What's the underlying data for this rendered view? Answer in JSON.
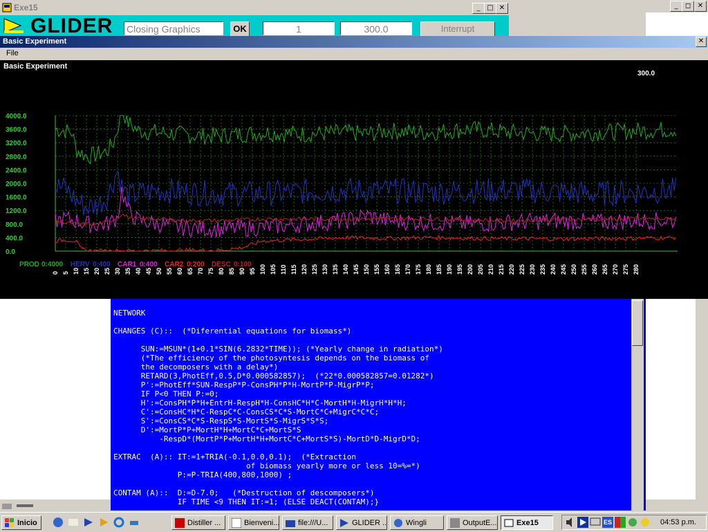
{
  "top_window": {
    "title": "Exe15",
    "logo_text": "GLIDER",
    "status_field": "Closing Graphics",
    "ok_label": "OK",
    "counter_field": "1",
    "time_field": "300.0",
    "interrupt_label": "Interrupt",
    "controls": [
      "_",
      "□",
      "✕"
    ]
  },
  "right_window": {
    "controls": [
      "_",
      "◻",
      "✕"
    ]
  },
  "experiment_window": {
    "title": "Basic Experiment",
    "menu": [
      "File"
    ],
    "chart_title": "Basic Experiment",
    "time_display": "300.0",
    "close_label": "✕"
  },
  "chart_data": {
    "type": "line",
    "title": "Basic Experiment",
    "ylim": [
      0,
      4000
    ],
    "y_ticks": [
      "4000.0",
      "3600.0",
      "3200.0",
      "2800.0",
      "2400.0",
      "2000.0",
      "1600.0",
      "1200.0",
      "800.0",
      "400.0",
      "0.0"
    ],
    "x_ticks": [
      "0",
      "5",
      "10",
      "15",
      "20",
      "25",
      "30",
      "35",
      "40",
      "45",
      "50",
      "55",
      "60",
      "65",
      "70",
      "75",
      "80",
      "85",
      "90",
      "95",
      "100",
      "105",
      "110",
      "115",
      "120",
      "125",
      "130",
      "135",
      "140",
      "145",
      "150",
      "155",
      "160",
      "165",
      "170",
      "175",
      "180",
      "185",
      "190",
      "195",
      "200",
      "205",
      "210",
      "215",
      "220",
      "225",
      "230",
      "235",
      "240",
      "245",
      "250",
      "255",
      "260",
      "265",
      "270",
      "275",
      "280"
    ],
    "xlim": [
      0,
      300
    ],
    "grid": true,
    "legend_position": "bottom-left",
    "series": [
      {
        "name": "PROD",
        "scale": "0:4000",
        "color": "#22aa22",
        "x": [
          0,
          5,
          8,
          10,
          15,
          20,
          25,
          28,
          30,
          32,
          35,
          40,
          50,
          60,
          70,
          80,
          90,
          100,
          120,
          140,
          150,
          160,
          180,
          200,
          220,
          240,
          260,
          280,
          300
        ],
        "y": [
          3600,
          3550,
          3500,
          3000,
          2800,
          2850,
          2950,
          3200,
          3600,
          4200,
          3800,
          3550,
          3500,
          3450,
          3400,
          3400,
          3450,
          3500,
          3450,
          3500,
          3450,
          3550,
          3500,
          3600,
          3500,
          3450,
          3500,
          3550,
          3600
        ]
      },
      {
        "name": "HERV",
        "scale": "0:400",
        "color": "#2233bb",
        "x": [
          0,
          5,
          10,
          15,
          20,
          25,
          30,
          32,
          35,
          40,
          50,
          60,
          80,
          100,
          140,
          180,
          220,
          260,
          300
        ],
        "y": [
          1900,
          1850,
          1500,
          1300,
          1350,
          1600,
          2400,
          1900,
          1600,
          1700,
          1800,
          1750,
          1700,
          1700,
          1800,
          1750,
          1800,
          1700,
          1800
        ]
      },
      {
        "name": "CAR1",
        "scale": "0:400",
        "color": "#dd22dd",
        "x": [
          0,
          5,
          10,
          15,
          20,
          25,
          30,
          32,
          35,
          40,
          50,
          60,
          80,
          100,
          120,
          140,
          150,
          160,
          180,
          200,
          220,
          240,
          260,
          280,
          300
        ],
        "y": [
          900,
          950,
          900,
          800,
          780,
          800,
          1000,
          1800,
          1200,
          900,
          800,
          700,
          650,
          700,
          800,
          900,
          1050,
          900,
          850,
          800,
          850,
          900,
          850,
          900,
          900
        ]
      },
      {
        "name": "CAR2",
        "scale": "0:200",
        "color": "#ee2222",
        "x": [
          0,
          5,
          10,
          12,
          15,
          20,
          30,
          32,
          35,
          40,
          60,
          80,
          90,
          100,
          120,
          140,
          160,
          180,
          200,
          240,
          280,
          300
        ],
        "y": [
          300,
          330,
          300,
          80,
          10,
          10,
          10,
          10,
          10,
          10,
          20,
          30,
          100,
          300,
          350,
          400,
          380,
          400,
          380,
          360,
          380,
          400
        ]
      },
      {
        "name": "DESC",
        "scale": "0:100",
        "color": "#bb2222",
        "x": [
          0,
          5,
          10,
          15,
          20,
          25,
          30,
          32,
          35,
          40,
          50,
          60,
          80,
          100,
          140,
          180,
          220,
          260,
          300
        ],
        "y": [
          900,
          850,
          800,
          800,
          800,
          850,
          1000,
          1100,
          1000,
          950,
          950,
          900,
          900,
          950,
          950,
          950,
          900,
          950,
          950
        ]
      }
    ]
  },
  "code": {
    "lines": [
      "NETWORK",
      "",
      "CHANGES (C)::  (*Diferential equations for biomass*)",
      "",
      "      SUN:=MSUN*(1+0.1*SIN(6.2832*TIME)); (*Yearly change in radiation*)",
      "      (*The efficiency of the photosyntesis depends on the biomass of",
      "      the decomposers with a delay*)",
      "      RETARD(3,PhotEff,0.5,D*0.000582857);  (*22*0.000582857=0.01282*)",
      "      P':=PhotEff*SUN-RespP*P-ConsPH*P*H-MortP*P-MigrP*P;",
      "      IF P<0 THEN P:=0;",
      "      H':=ConsPH*P*H+EntrH-RespH*H-ConsHC*H*C-MortH*H-MigrH*H*H;",
      "      C':=ConsHC*H*C-RespC*C-ConsCS*C*S-MortC*C+MigrC*C*C;",
      "      S':=ConsCS*C*S-RespS*S-MortS*S-MigrS*S*S;",
      "      D':=MortP*P+MortH*H+MortC*C+MortS*S",
      "          -RespD*(MortP*P+MortH*H+MortC*C+MortS*S)-MortD*D-MigrD*D;",
      "",
      "EXTRAC  (A):: IT:=1+TRIA(-0.1,0.0,0.1);  (*Extraction",
      "                             of biomass yearly more or less 10=%=*)",
      "              P:=P-TRIA(400,800,1000) ;",
      "",
      "CONTAM (A)::  D:=D-7.0;   (*Destruction of descomposers*)",
      "              IF TIME <9 THEN IT:=1; (ELSE DEACT(CONTAM);}"
    ]
  },
  "taskbar": {
    "start_label": "Inicio",
    "tasks": [
      "Distiller ...",
      "Bienveni...",
      "file:///U...",
      "GLIDER ...",
      "Wingli",
      "OutputE...",
      "Exe15"
    ],
    "active_task": "Exe15",
    "language": "ES",
    "clock": "04:53 p.m."
  },
  "colors": {
    "desktop_cyan": "#00cccc",
    "code_bg": "#0000ff",
    "chart_bg": "#000000",
    "title_gradient": "#0a246a"
  }
}
